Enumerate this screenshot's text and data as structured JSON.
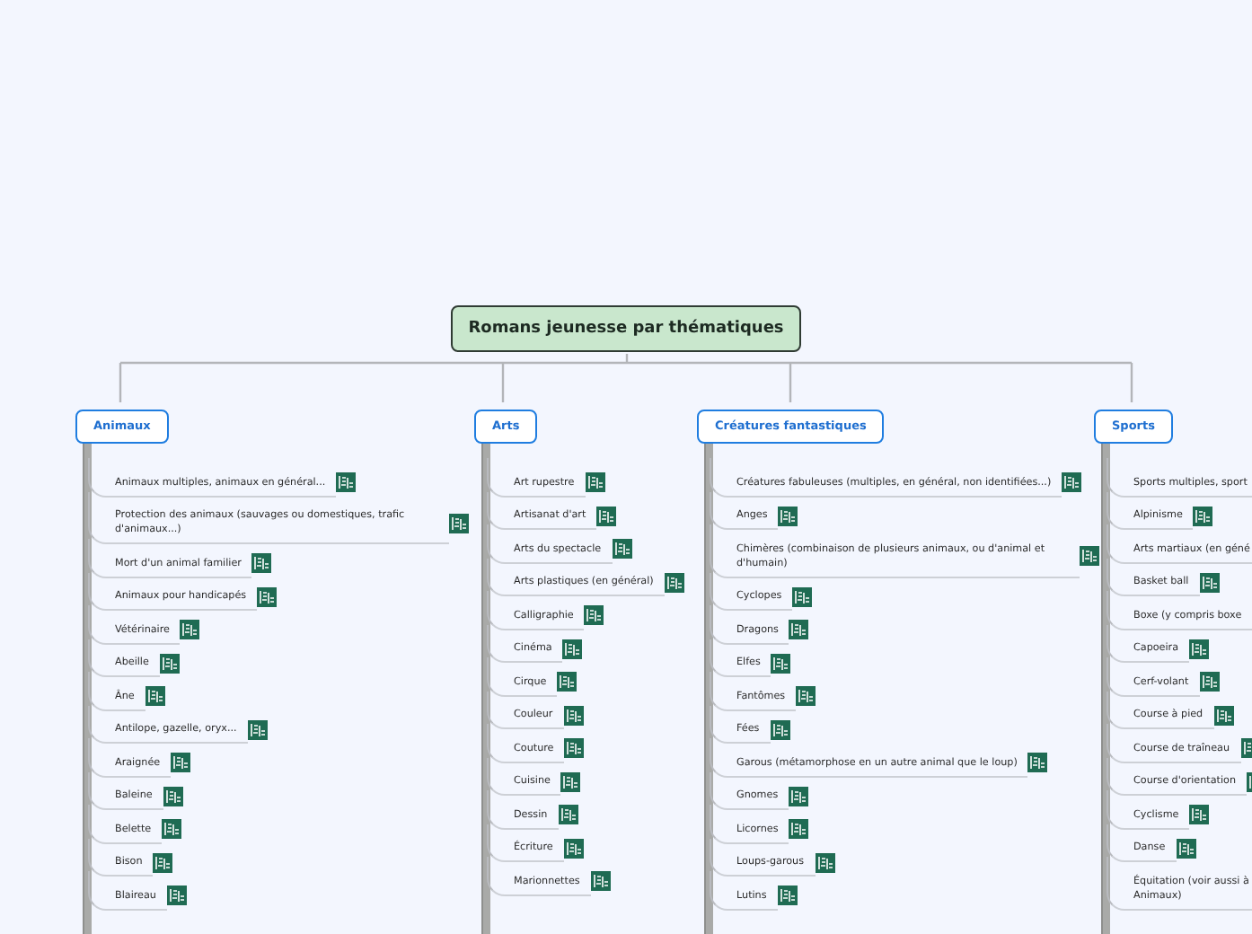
{
  "root": {
    "title": "Romans jeunesse par thématiques"
  },
  "branches": [
    {
      "title": "Animaux",
      "items": [
        {
          "label": "Animaux multiples, animaux en général...",
          "attachment": true
        },
        {
          "label": "Protection des animaux (sauvages ou domestiques, trafic d'animaux...)",
          "attachment": true
        },
        {
          "label": "Mort d'un animal familier",
          "attachment": true
        },
        {
          "label": "Animaux pour handicapés",
          "attachment": true
        },
        {
          "label": "Vétérinaire",
          "attachment": true
        },
        {
          "label": "Abeille",
          "attachment": true
        },
        {
          "label": "Âne",
          "attachment": true
        },
        {
          "label": "Antilope, gazelle, oryx...",
          "attachment": true
        },
        {
          "label": "Araignée",
          "attachment": true
        },
        {
          "label": "Baleine",
          "attachment": true
        },
        {
          "label": "Belette",
          "attachment": true
        },
        {
          "label": "Bison",
          "attachment": true
        },
        {
          "label": "Blaireau",
          "attachment": true
        }
      ]
    },
    {
      "title": "Arts",
      "items": [
        {
          "label": "Art rupestre",
          "attachment": true
        },
        {
          "label": "Artisanat d'art",
          "attachment": true
        },
        {
          "label": "Arts du spectacle",
          "attachment": true
        },
        {
          "label": "Arts plastiques (en général)",
          "attachment": true
        },
        {
          "label": "Calligraphie",
          "attachment": true
        },
        {
          "label": "Cinéma",
          "attachment": true
        },
        {
          "label": "Cirque",
          "attachment": true
        },
        {
          "label": "Couleur",
          "attachment": true
        },
        {
          "label": "Couture",
          "attachment": true
        },
        {
          "label": "Cuisine",
          "attachment": true
        },
        {
          "label": "Dessin",
          "attachment": true
        },
        {
          "label": "Écriture",
          "attachment": true
        },
        {
          "label": "Marionnettes",
          "attachment": true
        }
      ]
    },
    {
      "title": "Créatures fantastiques",
      "items": [
        {
          "label": "Créatures fabuleuses (multiples, en général, non identifiées...)",
          "attachment": true
        },
        {
          "label": "Anges",
          "attachment": true
        },
        {
          "label": "Chimères (combinaison de plusieurs animaux, ou d'animal et d'humain)",
          "attachment": true
        },
        {
          "label": "Cyclopes",
          "attachment": true
        },
        {
          "label": "Dragons",
          "attachment": true
        },
        {
          "label": "Elfes",
          "attachment": true
        },
        {
          "label": "Fantômes",
          "attachment": true
        },
        {
          "label": "Fées",
          "attachment": true
        },
        {
          "label": "Garous (métamorphose en un autre animal que le loup)",
          "attachment": true
        },
        {
          "label": "Gnomes",
          "attachment": true
        },
        {
          "label": "Licornes",
          "attachment": true
        },
        {
          "label": "Loups-garous",
          "attachment": true
        },
        {
          "label": "Lutins",
          "attachment": true
        }
      ]
    },
    {
      "title": "Sports",
      "items": [
        {
          "label": "Sports multiples, sport",
          "attachment": false
        },
        {
          "label": "Alpinisme",
          "attachment": true
        },
        {
          "label": "Arts martiaux (en géné",
          "attachment": false
        },
        {
          "label": "Basket ball",
          "attachment": true
        },
        {
          "label": "Boxe (y compris boxe",
          "attachment": false
        },
        {
          "label": "Capoeira",
          "attachment": true
        },
        {
          "label": "Cerf-volant",
          "attachment": true
        },
        {
          "label": "Course à pied",
          "attachment": true
        },
        {
          "label": "Course de traîneau",
          "attachment": true
        },
        {
          "label": "Course d'orientation",
          "attachment": true
        },
        {
          "label": "Cyclisme",
          "attachment": true
        },
        {
          "label": "Danse",
          "attachment": true
        },
        {
          "label": "Équitation (voir aussi à\nAnimaux)",
          "attachment": false
        }
      ]
    }
  ]
}
